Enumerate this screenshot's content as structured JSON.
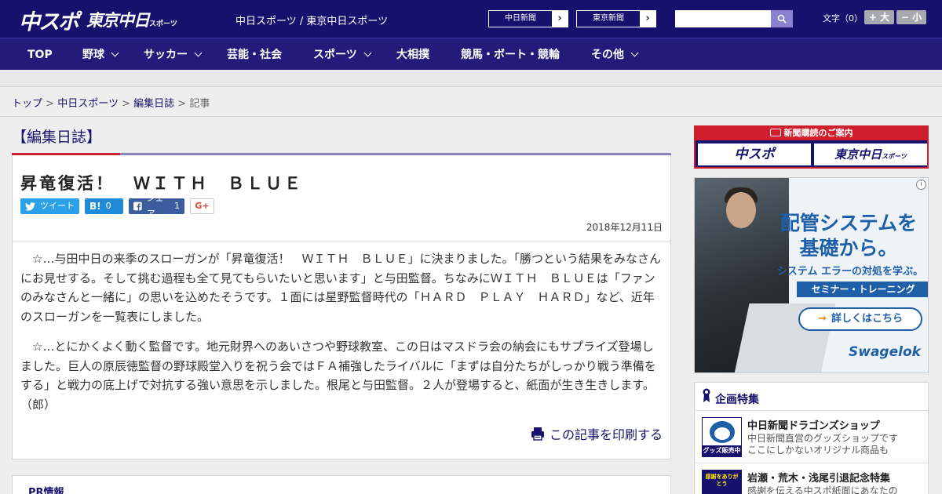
{
  "header": {
    "logo_main": "中スポ",
    "logo_tokyo": "東京中日",
    "logo_tokyo_small": "スポーツ",
    "site_title": "中日スポーツ / 東京中日スポーツ",
    "paper_links": [
      "中日新聞",
      "東京新聞"
    ],
    "search_placeholder": "",
    "font_size_label": "文字（0）",
    "font_bigger": "+ 大",
    "font_smaller": "− 小"
  },
  "nav": {
    "items": [
      {
        "label": "TOP",
        "dropdown": false
      },
      {
        "label": "野球",
        "dropdown": true
      },
      {
        "label": "サッカー",
        "dropdown": true
      },
      {
        "label": "芸能・社会",
        "dropdown": false
      },
      {
        "label": "スポーツ",
        "dropdown": true
      },
      {
        "label": "大相撲",
        "dropdown": false
      },
      {
        "label": "競馬・ボート・競輪",
        "dropdown": false
      },
      {
        "label": "その他",
        "dropdown": true
      }
    ]
  },
  "breadcrumb": {
    "items": [
      "トップ",
      "中日スポーツ",
      "編集日誌"
    ],
    "current": "記事",
    "separator": ">"
  },
  "article": {
    "section": "【編集日誌】",
    "title": "昇竜復活！　ＷＩＴＨ　ＢＬＵＥ",
    "share": {
      "tweet": "ツイート",
      "hatena": "B!",
      "hatena_count": "0",
      "facebook": "シェア",
      "facebook_count": "1",
      "gplus": "G+"
    },
    "date": "2018年12月11日",
    "paragraphs": [
      "☆…与田中日の来季のスローガンが「昇竜復活！　ＷＩＴＨ　ＢＬＵＥ」に決まりました。「勝つという結果をみなさんにお見せする。そして挑む過程も全て見てもらいたいと思います」と与田監督。ちなみにＷＩＴＨ　ＢＬＵＥは「ファンのみなさんと一緒に」の思いを込めたそうです。１面には星野監督時代の「ＨＡＲＤ　ＰＬＡＹ　ＨＡＲＤ」など、近年のスローガンを一覧表にしました。",
      "☆…とにかくよく動く監督です。地元財界へのあいさつや野球教室、この日はマスドラ会の納会にもサプライズ登場しました。巨人の原辰徳監督の野球殿堂入りを祝う会ではＦＡ補強したライバルに「まずは自分たちがしっかり戦う準備をする」と戦力の底上げで対抗する強い意思を示しました。根尾と与田監督。２人が登場すると、紙面が生き生きします。（郎）"
    ],
    "print_label": "この記事を印刷する"
  },
  "pr": {
    "title": "PR情報"
  },
  "sidebar": {
    "subscription": {
      "header": "新聞購読のご案内",
      "paper1": "中スポ",
      "paper2": "東京中日",
      "paper2_small": "スポーツ"
    },
    "ad": {
      "headline1": "配管システムを",
      "headline2": "基礎から。",
      "sub": "システム エラーの対処を学ぶ。",
      "strip": "セミナー・トレーニング",
      "cta": "詳しくはこちら",
      "brand": "Swagelok",
      "info": "i"
    },
    "features": {
      "title": "企画特集",
      "items": [
        {
          "title": "中日新聞ドラゴンズショップ",
          "desc1": "中日新聞直営のグッズショップです",
          "desc2": "ここにしかないオリジナル商品も",
          "thumb_label": "グッズ販売中"
        },
        {
          "title": "岩瀬・荒木・浅尾引退記念特集",
          "desc1": "感謝を伝える中スポ紙面にあなたの",
          "desc2": "",
          "thumb_label": "感謝をありがとう"
        }
      ]
    }
  },
  "colors": {
    "header_bg": "#17116e",
    "nav_bg": "#221b7a",
    "accent_red": "#d01f2c",
    "link": "#17116e",
    "twitter": "#2aa0e8",
    "hatena": "#1f8ad8",
    "facebook": "#3b5c9f"
  },
  "icons": [
    "search-icon",
    "chevron-down-icon",
    "twitter-icon",
    "facebook-icon",
    "print-icon",
    "ribbon-icon",
    "newspaper-icon"
  ]
}
